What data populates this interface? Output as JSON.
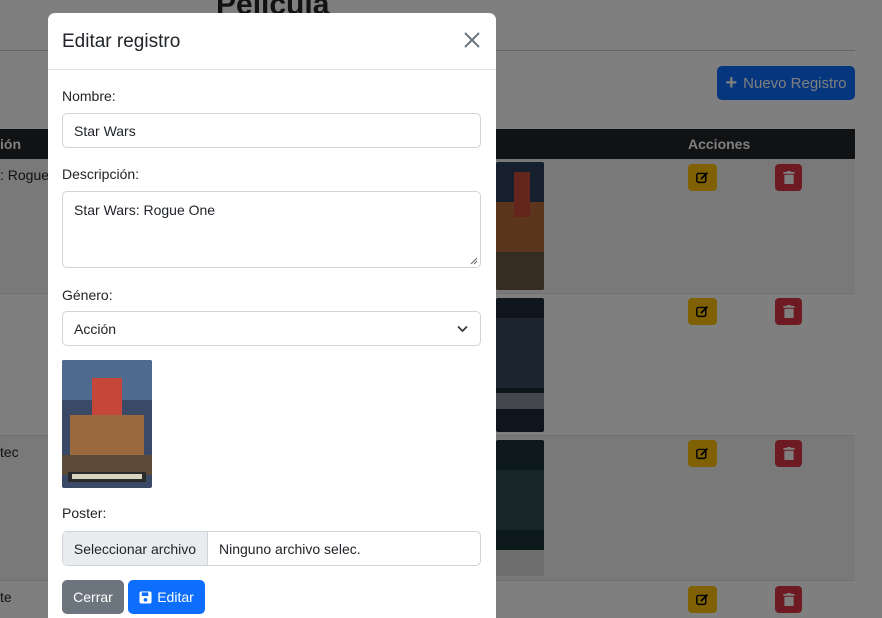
{
  "background": {
    "page_title": "Pelicula",
    "new_button_label": "Nuevo Registro",
    "table": {
      "headers": {
        "description": "ión",
        "actions": "Acciones"
      },
      "rows": [
        {
          "description": ": Rogue"
        },
        {
          "description": ""
        },
        {
          "description": "tec"
        },
        {
          "description": "te"
        }
      ]
    }
  },
  "modal": {
    "title": "Editar registro",
    "fields": {
      "nombre": {
        "label": "Nombre:",
        "value": "Star Wars"
      },
      "descripcion": {
        "label": "Descripción:",
        "value": "Star Wars: Rogue One"
      },
      "genero": {
        "label": "Género:",
        "selected": "Acción"
      },
      "poster": {
        "label": "Poster:",
        "button_label": "Seleccionar archivo",
        "file_name": "Ninguno archivo selec."
      }
    },
    "buttons": {
      "close": "Cerrar",
      "edit": "Editar"
    }
  },
  "colors": {
    "primary": "#0d6efd",
    "secondary": "#6c757d",
    "warning": "#ffc107",
    "danger": "#dc3545",
    "table_header": "#212529"
  },
  "icons": [
    "close-icon",
    "plus-icon",
    "edit-icon",
    "trash-icon",
    "save-icon",
    "chevron-down-icon",
    "resize-grip-icon"
  ]
}
